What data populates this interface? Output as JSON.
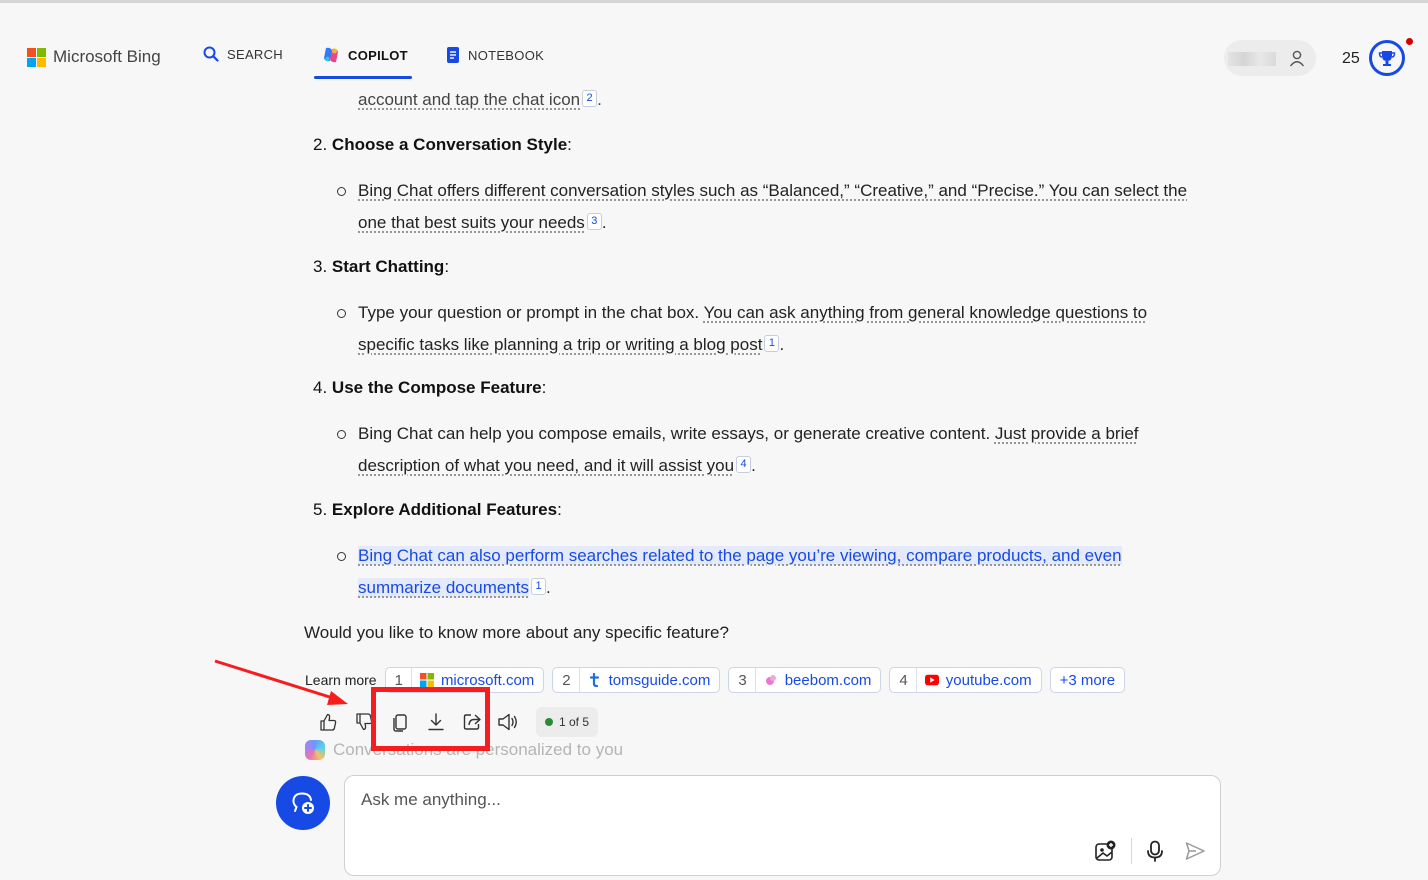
{
  "header": {
    "logo_text": "Microsoft Bing",
    "tabs": [
      {
        "label": "SEARCH",
        "icon": "search-icon"
      },
      {
        "label": "COPILOT",
        "icon": "copilot-icon",
        "active": true
      },
      {
        "label": "NOTEBOOK",
        "icon": "notebook-icon"
      }
    ],
    "points": "25",
    "accent_color": "#174ae4"
  },
  "chat": {
    "fragment": {
      "text": "account and tap the chat icon",
      "cite": "2",
      "end": "."
    },
    "steps": [
      {
        "number": "2.",
        "title": "Choose a Conversation Style",
        "colon": ":",
        "bullet": {
          "plain": "",
          "linked": "Bing Chat offers different conversation styles such as “Balanced,” “Creative,” and “Precise.” You can select the one that best suits your needs",
          "cite": "3",
          "end": "."
        }
      },
      {
        "number": "3.",
        "title": "Start Chatting",
        "colon": ":",
        "bullet": {
          "plain": "Type your question or prompt in the chat box. ",
          "linked": "You can ask anything from general knowledge questions to specific tasks like planning a trip or writing a blog post",
          "cite": "1",
          "end": "."
        }
      },
      {
        "number": "4.",
        "title": "Use the Compose Feature",
        "colon": ":",
        "bullet": {
          "plain": "Bing Chat can help you compose emails, write essays, or generate creative content. ",
          "linked": "Just provide a brief description of what you need, and it will assist you",
          "cite": "4",
          "end": "."
        }
      },
      {
        "number": "5.",
        "title": "Explore Additional Features",
        "colon": ":",
        "bullet": {
          "plain": "",
          "linked": "Bing Chat can also perform searches related to the page you’re viewing, compare products, and even summarize documents",
          "cite": "1",
          "end": ".",
          "highlighted": true
        }
      }
    ],
    "question": "Would you like to know more about any specific feature?",
    "learn_more": {
      "label": "Learn more",
      "sources": [
        {
          "num": "1",
          "domain": "microsoft.com",
          "icon": "microsoft-icon"
        },
        {
          "num": "2",
          "domain": "tomsguide.com",
          "icon": "tomsguide-icon"
        },
        {
          "num": "3",
          "domain": "beebom.com",
          "icon": "beebom-icon"
        },
        {
          "num": "4",
          "domain": "youtube.com",
          "icon": "youtube-icon"
        }
      ],
      "more": "+3 more"
    },
    "actions": [
      "thumbs-up-icon",
      "thumbs-down-icon",
      "copy-icon",
      "download-icon",
      "share-icon",
      "speaker-icon"
    ],
    "counter": "1 of 5",
    "personalized": "Conversations are personalized to you"
  },
  "composer": {
    "placeholder": "Ask me anything..."
  },
  "annotation": {
    "highlight_color": "#f51d1d"
  }
}
